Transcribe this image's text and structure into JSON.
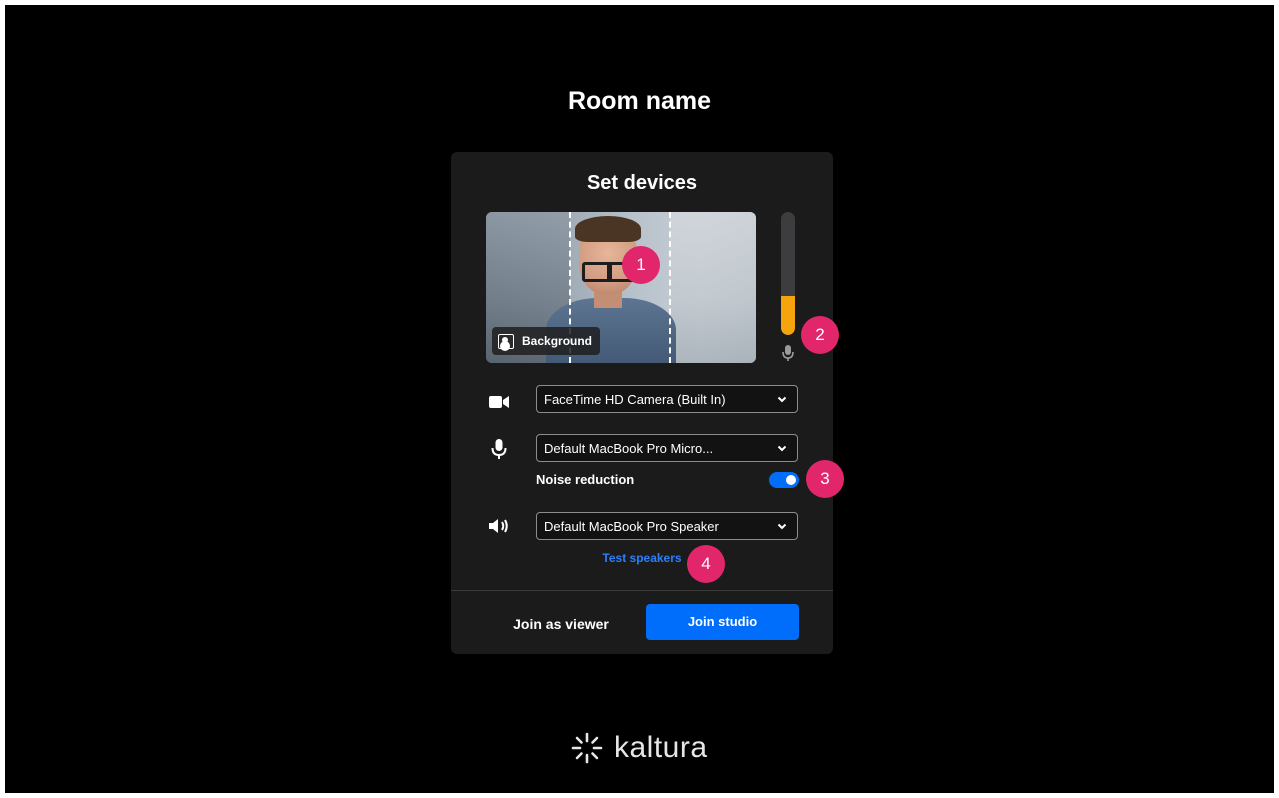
{
  "page": {
    "room_title": "Room name"
  },
  "card": {
    "title": "Set devices",
    "preview": {
      "background_button_label": "Background"
    },
    "mic_level": 0.32,
    "camera_select": {
      "value": "FaceTime HD Camera (Built In)",
      "icon": "video-camera-icon"
    },
    "mic_select": {
      "value": "Default MacBook Pro Micro...",
      "icon": "microphone-icon"
    },
    "noise_reduction": {
      "label": "Noise reduction",
      "enabled": true
    },
    "speaker_select": {
      "value": "Default MacBook Pro Speaker",
      "icon": "speaker-icon"
    },
    "test_speakers_label": "Test speakers",
    "join_viewer_label": "Join as viewer",
    "join_studio_label": "Join studio"
  },
  "badges": [
    "1",
    "2",
    "3",
    "4"
  ],
  "brand": {
    "logo_text": "kaltura"
  },
  "colors": {
    "accent": "#006efa",
    "badge": "#e2266b",
    "meter": "#f5a40d",
    "link": "#2d7ff9",
    "card": "#1b1b1c"
  }
}
